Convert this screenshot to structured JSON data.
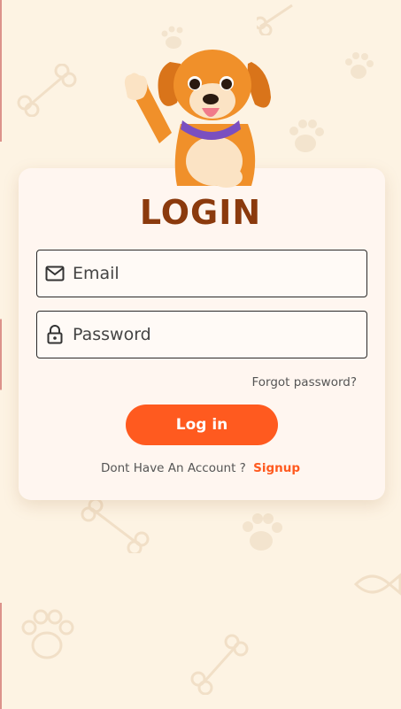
{
  "title": "LOGIN",
  "email": {
    "placeholder": "Email",
    "icon": "mail-icon"
  },
  "password": {
    "placeholder": "Password",
    "icon": "lock-icon"
  },
  "forgot_label": "Forgot password?",
  "login_label": "Log in",
  "signup_prompt": "Dont Have An Account ?",
  "signup_label": "Signup",
  "colors": {
    "background": "#fdf3e3",
    "card": "#fff6f0",
    "title": "#8b3a0d",
    "accent": "#ff5a1f"
  }
}
